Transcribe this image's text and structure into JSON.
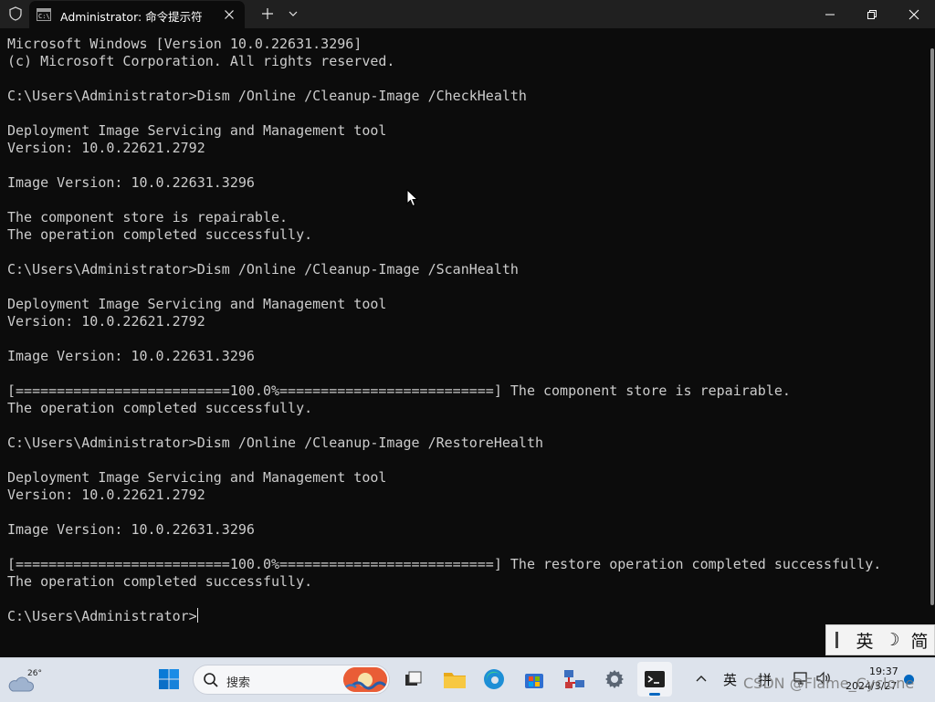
{
  "tab": {
    "title": "Administrator: 命令提示符",
    "icon": "cmd-icon",
    "icon_glyph": "C:\\"
  },
  "window_controls": [
    "minimize",
    "maximize",
    "close"
  ],
  "console": {
    "lines": [
      "Microsoft Windows [Version 10.0.22631.3296]",
      "(c) Microsoft Corporation. All rights reserved.",
      "",
      "C:\\Users\\Administrator>Dism /Online /Cleanup-Image /CheckHealth",
      "",
      "Deployment Image Servicing and Management tool",
      "Version: 10.0.22621.2792",
      "",
      "Image Version: 10.0.22631.3296",
      "",
      "The component store is repairable.",
      "The operation completed successfully.",
      "",
      "C:\\Users\\Administrator>Dism /Online /Cleanup-Image /ScanHealth",
      "",
      "Deployment Image Servicing and Management tool",
      "Version: 10.0.22621.2792",
      "",
      "Image Version: 10.0.22631.3296",
      "",
      "[==========================100.0%==========================] The component store is repairable.",
      "The operation completed successfully.",
      "",
      "C:\\Users\\Administrator>Dism /Online /Cleanup-Image /RestoreHealth",
      "",
      "Deployment Image Servicing and Management tool",
      "Version: 10.0.22621.2792",
      "",
      "Image Version: 10.0.22631.3296",
      "",
      "[==========================100.0%==========================] The restore operation completed successfully.",
      "The operation completed successfully.",
      ""
    ],
    "prompt": "C:\\Users\\Administrator>"
  },
  "ime": {
    "items": [
      "英",
      "☽",
      "简"
    ]
  },
  "taskbar": {
    "weather_temp": "26°",
    "search_placeholder": "搜索",
    "apps": [
      "windows-start",
      "task-view",
      "file-explorer",
      "edge",
      "microsoft-store",
      "network-tool",
      "settings",
      "terminal"
    ],
    "tray_chevron": "^",
    "lang": "英",
    "ime_mode": "拼",
    "clock_time": "19:37",
    "clock_date": "2024/3/27",
    "accent": "#0067c0"
  },
  "watermark": "CSDN @Flame_Cyclone",
  "colors": {
    "console_bg": "#0c0c0c",
    "console_fg": "#cccccc",
    "titlebar_bg": "#202020"
  }
}
